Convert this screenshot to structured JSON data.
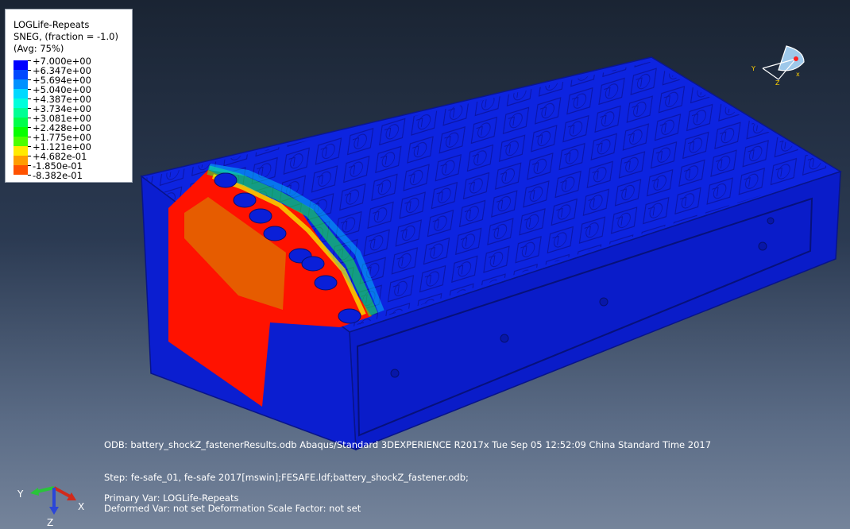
{
  "legend": {
    "title": "LOGLife-Repeats",
    "subtitle": "SNEG, (fraction = -1.0)",
    "averaging": "(Avg: 75%)",
    "values": [
      "+7.000e+00",
      "+6.347e+00",
      "+5.694e+00",
      "+5.040e+00",
      "+4.387e+00",
      "+3.734e+00",
      "+3.081e+00",
      "+2.428e+00",
      "+1.775e+00",
      "+1.121e+00",
      "+4.682e-01",
      "-1.850e-01",
      "-8.382e-01"
    ],
    "colors": [
      "#0000ff",
      "#0049ff",
      "#0091ff",
      "#00d9ff",
      "#00ffdc",
      "#00ff94",
      "#00ff4a",
      "#06ff00",
      "#4cff00",
      "#ffea00",
      "#ff9c00",
      "#ff5200",
      "#ff0000"
    ]
  },
  "info": {
    "odb_line": "ODB: battery_shockZ_fastenerResults.odb    Abaqus/Standard 3DEXPERIENCE R2017x    Tue Sep 05 12:52:09 China Standard Time 2017",
    "step_line": "Step: fe-safe_01, fe-safe 2017[mswin];FESAFE.ldf;battery_shockZ_fastener.odb;",
    "primary_var": "Primary Var: LOGLife-Repeats",
    "deformed_var": "Deformed Var: not set   Deformation Scale Factor: not set"
  },
  "triad": {
    "x_label": "X",
    "y_label": "Y",
    "z_label": "Z"
  },
  "view_cube": {
    "x_label": "x",
    "y_label": "Y",
    "z_label": "Z"
  },
  "model": {
    "name": "battery pack contour",
    "low_life_color": "#ff1a00",
    "high_life_color": "#0a1fd8"
  }
}
